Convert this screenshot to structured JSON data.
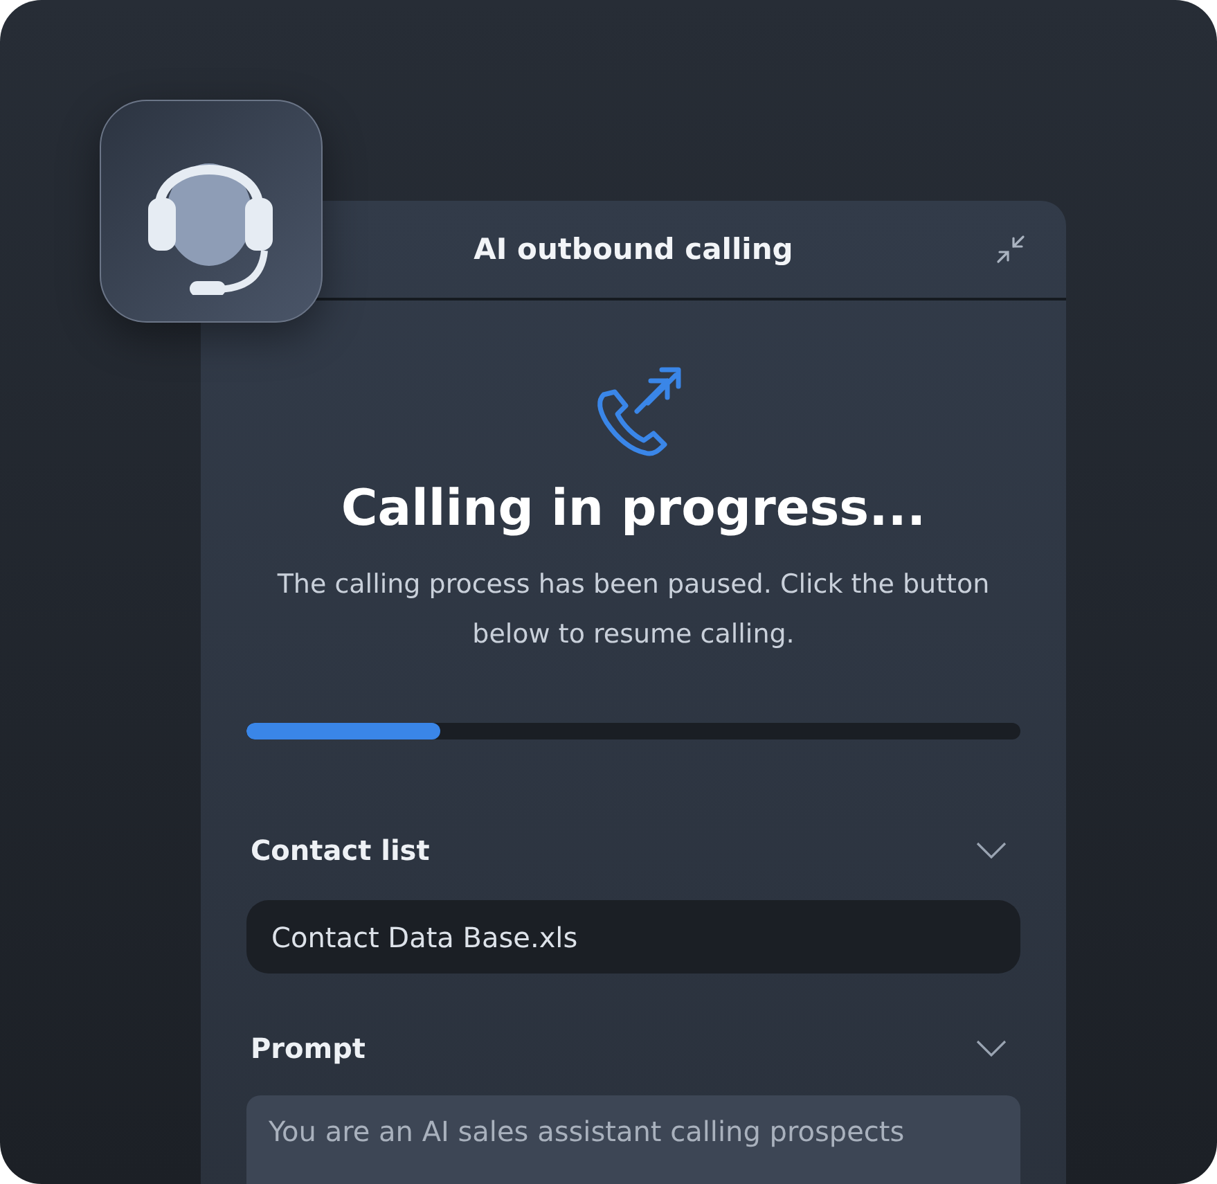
{
  "window": {
    "title": "AI outbound calling"
  },
  "status": {
    "heading": "Calling in progress...",
    "message": "The calling process has been paused. Click the button below to resume calling.",
    "level": 0.25
  },
  "sections": [
    {
      "label": "Contact list",
      "kind": "file",
      "value": "Contact Data Base.xls"
    },
    {
      "label": "Prompt",
      "kind": "text",
      "value": "You are an AI sales assistant calling prospects"
    }
  ]
}
